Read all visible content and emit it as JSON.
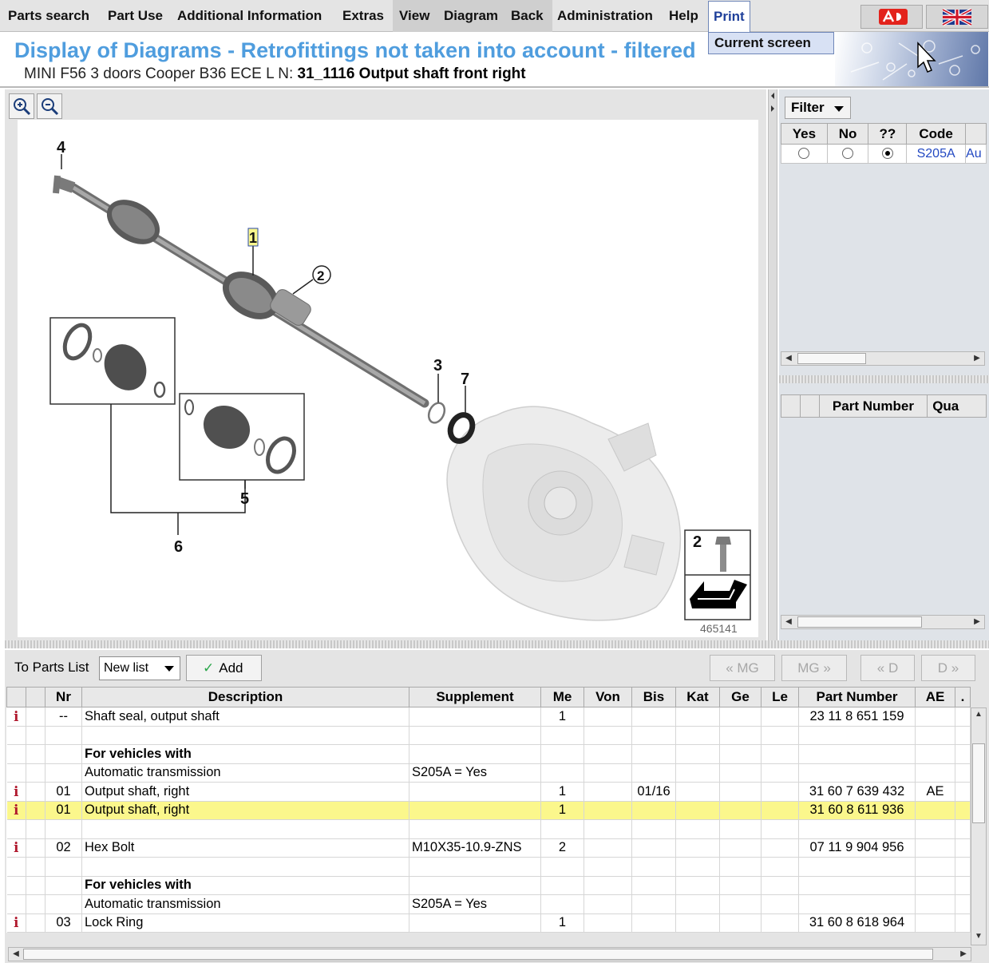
{
  "menu": {
    "items": [
      "Parts search",
      "Part Use",
      "Additional Information",
      "Extras",
      "View",
      "Diagram",
      "Back",
      "Administration",
      "Help",
      "Print"
    ],
    "print_dropdown_item": "Current screen"
  },
  "header": {
    "title": "Display of Diagrams - Retrofittings not taken into account - filtered",
    "vehicle": "MINI F56 3 doors Cooper B36 ECE  L N:",
    "diagram_name": "31_1116 Output shaft front right"
  },
  "diagram": {
    "callouts": [
      "4",
      "1",
      "2",
      "3",
      "7",
      "5",
      "6"
    ],
    "inset_callout": "2",
    "image_number": "465141"
  },
  "filter": {
    "button_label": "Filter",
    "columns": [
      "Yes",
      "No",
      "??",
      "Code",
      ""
    ],
    "rows": [
      {
        "selected": "??",
        "code": "S205A",
        "description": "Au"
      }
    ]
  },
  "part_panel": {
    "columns": [
      "",
      "",
      "Part Number",
      "Qua"
    ]
  },
  "toolbar": {
    "to_parts_list_label": "To Parts List",
    "list_select_value": "New list",
    "add_label": "Add",
    "nav_buttons": [
      "« MG",
      "MG »",
      "« D",
      "D »"
    ]
  },
  "parts_table": {
    "columns": [
      "",
      "",
      "Nr",
      "Description",
      "Supplement",
      "Me",
      "Von",
      "Bis",
      "Kat",
      "Ge",
      "Le",
      "Part Number",
      "AE",
      "."
    ],
    "rows": [
      {
        "info": "i",
        "nr": "--",
        "description": "Shaft seal, output shaft",
        "supplement": "",
        "me": "1",
        "von": "",
        "bis": "",
        "part_number": "23 11 8 651 159",
        "ae": "",
        "highlight": false,
        "bold": false
      },
      {
        "info": "",
        "nr": "",
        "description": "",
        "supplement": "",
        "me": "",
        "von": "",
        "bis": "",
        "part_number": "",
        "ae": "",
        "highlight": false,
        "bold": false
      },
      {
        "info": "",
        "nr": "",
        "description": "For vehicles with",
        "supplement": "",
        "me": "",
        "von": "",
        "bis": "",
        "part_number": "",
        "ae": "",
        "highlight": false,
        "bold": true
      },
      {
        "info": "",
        "nr": "",
        "description": "Automatic transmission",
        "supplement": "S205A = Yes",
        "me": "",
        "von": "",
        "bis": "",
        "part_number": "",
        "ae": "",
        "highlight": false,
        "bold": false
      },
      {
        "info": "i",
        "nr": "01",
        "description": "Output shaft, right",
        "supplement": "",
        "me": "1",
        "von": "",
        "bis": "01/16",
        "part_number": "31 60 7 639 432",
        "ae": "AE",
        "highlight": false,
        "bold": false
      },
      {
        "info": "i",
        "nr": "01",
        "description": "Output shaft, right",
        "supplement": "",
        "me": "1",
        "von": "",
        "bis": "",
        "part_number": "31 60 8 611 936",
        "ae": "",
        "highlight": true,
        "bold": false
      },
      {
        "info": "",
        "nr": "",
        "description": "",
        "supplement": "",
        "me": "",
        "von": "",
        "bis": "",
        "part_number": "",
        "ae": "",
        "highlight": false,
        "bold": false
      },
      {
        "info": "i",
        "nr": "02",
        "description": "Hex Bolt",
        "supplement": "M10X35-10.9-ZNS",
        "me": "2",
        "von": "",
        "bis": "",
        "part_number": "07 11 9 904 956",
        "ae": "",
        "highlight": false,
        "bold": false
      },
      {
        "info": "",
        "nr": "",
        "description": "",
        "supplement": "",
        "me": "",
        "von": "",
        "bis": "",
        "part_number": "",
        "ae": "",
        "highlight": false,
        "bold": false
      },
      {
        "info": "",
        "nr": "",
        "description": "For vehicles with",
        "supplement": "",
        "me": "",
        "von": "",
        "bis": "",
        "part_number": "",
        "ae": "",
        "highlight": false,
        "bold": true
      },
      {
        "info": "",
        "nr": "",
        "description": "Automatic transmission",
        "supplement": "S205A = Yes",
        "me": "",
        "von": "",
        "bis": "",
        "part_number": "",
        "ae": "",
        "highlight": false,
        "bold": false
      },
      {
        "info": "i",
        "nr": "03",
        "description": "Lock Ring",
        "supplement": "",
        "me": "1",
        "von": "",
        "bis": "",
        "part_number": "31 60 8 618 964",
        "ae": "",
        "highlight": false,
        "bold": false
      }
    ]
  },
  "colors": {
    "title_blue": "#4f9dde",
    "highlight_yellow": "#fbf78c",
    "info_red": "#b0182d",
    "code_blue": "#2248c2"
  }
}
